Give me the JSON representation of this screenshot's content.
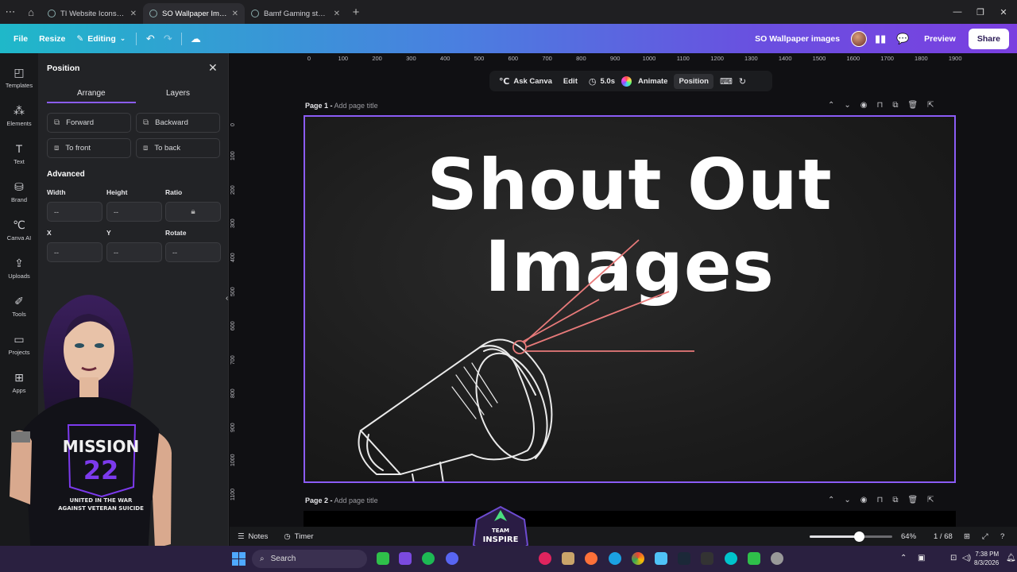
{
  "browser": {
    "tabs": [
      {
        "label": "TI Website Icons - ..."
      },
      {
        "label": "SO Wallpaper Imag..."
      },
      {
        "label": "Bamf Gaming stuff ..."
      }
    ]
  },
  "header": {
    "file": "File",
    "resize": "Resize",
    "editing": "Editing",
    "project_title": "SO Wallpaper images",
    "preview": "Preview",
    "share": "Share"
  },
  "rail": {
    "items": [
      {
        "label": "Templates"
      },
      {
        "label": "Elements"
      },
      {
        "label": "Text"
      },
      {
        "label": "Brand"
      },
      {
        "label": "Canva AI"
      },
      {
        "label": "Uploads"
      },
      {
        "label": "Tools"
      },
      {
        "label": "Projects"
      },
      {
        "label": "Apps"
      }
    ]
  },
  "panel": {
    "title": "Position",
    "tabs": {
      "arrange": "Arrange",
      "layers": "Layers"
    },
    "buttons": {
      "forward": "Forward",
      "backward": "Backward",
      "to_front": "To front",
      "to_back": "To back"
    },
    "advanced": "Advanced",
    "labels": {
      "width": "Width",
      "height": "Height",
      "ratio": "Ratio",
      "x": "X",
      "y": "Y",
      "rotate": "Rotate"
    },
    "values": {
      "width": "--",
      "height": "--",
      "x": "--",
      "y": "--",
      "rotate": "--"
    }
  },
  "ruler": {
    "h": [
      "0",
      "100",
      "200",
      "300",
      "400",
      "500",
      "600",
      "700",
      "800",
      "900",
      "1000",
      "1100",
      "1200",
      "1300",
      "1400",
      "1500",
      "1600",
      "1700",
      "1800",
      "1900"
    ],
    "v": [
      "0",
      "100",
      "200",
      "300",
      "400",
      "500",
      "600",
      "700",
      "800",
      "900",
      "1000",
      "1100"
    ]
  },
  "toolbar": {
    "ask_canva": "Ask Canva",
    "edit": "Edit",
    "duration": "5.0s",
    "animate": "Animate",
    "position": "Position"
  },
  "pages": {
    "page1_label": "Page 1 -",
    "page1_placeholder": "Add page title",
    "page2_label": "Page 2 -",
    "page2_placeholder": "Add page title"
  },
  "design": {
    "headline": "Shout Out Images"
  },
  "character": {
    "shirt_title": "MISSION",
    "shirt_number": "22",
    "shirt_caption_1": "UNITED IN THE WAR",
    "shirt_caption_2": "AGAINST VETERAN SUICIDE"
  },
  "logo": {
    "line1": "TEAM",
    "line2": "INSPIRE"
  },
  "statusbar": {
    "notes": "Notes",
    "timer": "Timer",
    "zoom": "64%",
    "zoom_fraction": 0.6,
    "pages": "1 / 68"
  },
  "taskbar": {
    "search": "Search",
    "time": "7:38 PM",
    "date": "8/3/2026"
  },
  "colors": {
    "accent": "#8b5cf6",
    "header_start": "#1fb8c9",
    "header_end": "#7a3fe0"
  }
}
